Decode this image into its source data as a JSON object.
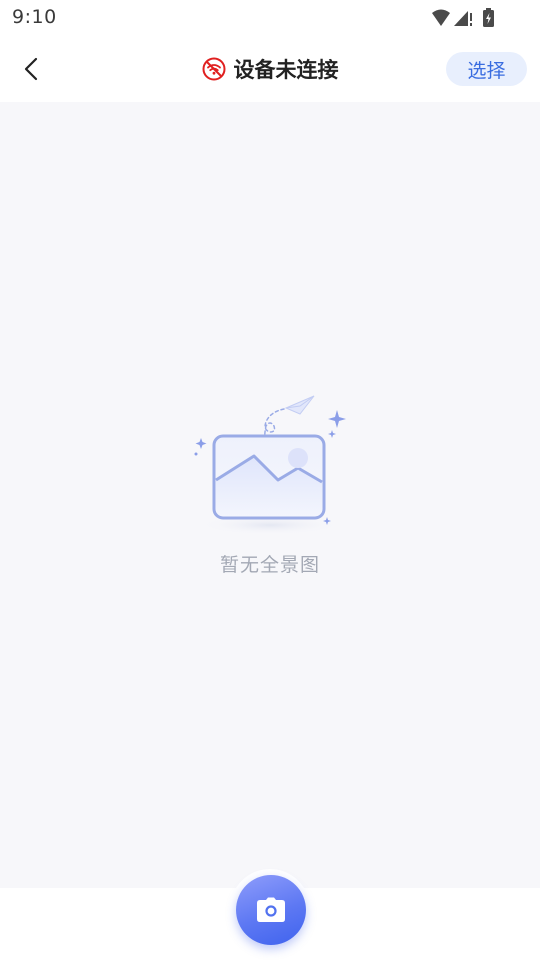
{
  "status_bar": {
    "time": "9:10"
  },
  "header": {
    "back_icon": "chevron-left-icon",
    "status_icon": "wifi-off-icon",
    "title": "设备未连接",
    "select_label": "选择"
  },
  "empty_state": {
    "illustration_icon": "image-placeholder-icon",
    "message": "暂无全景图"
  },
  "bottom_bar": {
    "camera_icon": "camera-icon"
  },
  "colors": {
    "accent": "#3a6de0",
    "select_bg": "#e8effd",
    "disconnected": "#e02020",
    "background": "#f7f7fa",
    "empty_text": "#a3a8b4"
  }
}
